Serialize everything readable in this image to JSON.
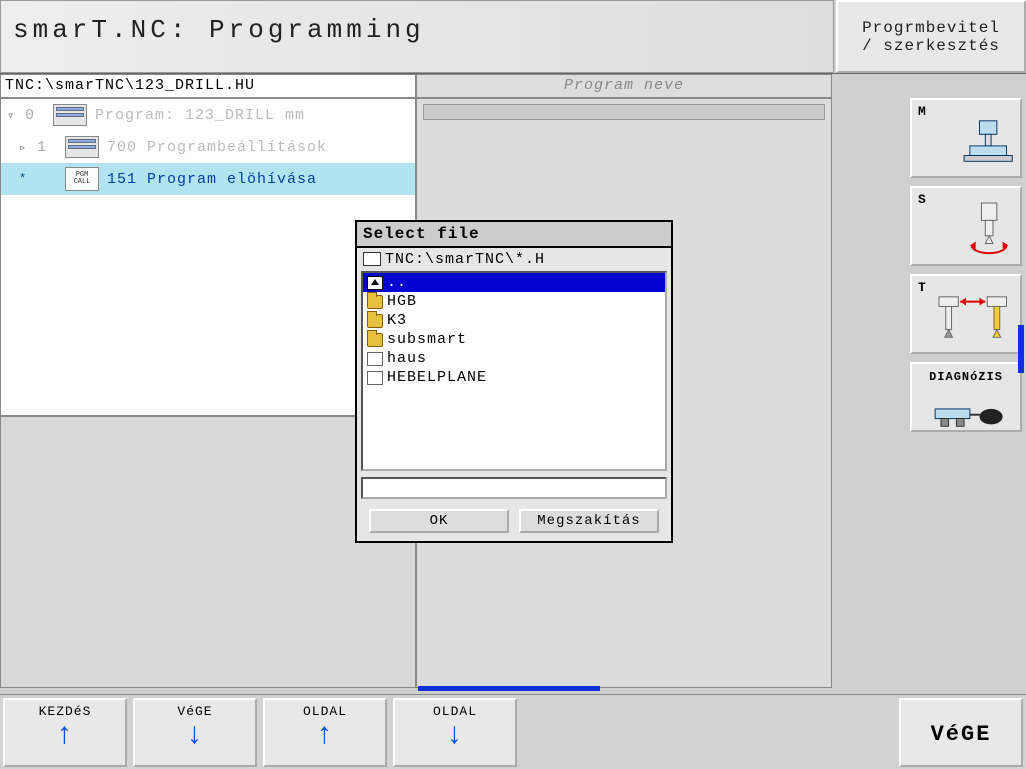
{
  "header": {
    "title": "smarT.NC: Programming",
    "mode_line1": "Progrmbevitel",
    "mode_line2": "/ szerkesztés"
  },
  "path": {
    "left": "TNC:\\smarTNC\\123_DRILL.HU",
    "right": "Program neve"
  },
  "tree": [
    {
      "marker": "▿",
      "index": "0",
      "icon": "blocks",
      "label": "Program: 123_DRILL mm",
      "dim": true,
      "selected": false
    },
    {
      "marker": "▹",
      "index": "1",
      "icon": "blocks",
      "label": "700 Programbeállítások",
      "dim": true,
      "selected": false
    },
    {
      "marker": "*",
      "index": "",
      "icon": "pgm",
      "label": "151 Program elöhívása",
      "dim": false,
      "selected": true
    }
  ],
  "dialog": {
    "title": "Select file",
    "path": "TNC:\\smarTNC\\*.H",
    "items": [
      {
        "type": "up",
        "name": "..",
        "selected": true
      },
      {
        "type": "folder",
        "name": "HGB",
        "selected": false
      },
      {
        "type": "folder",
        "name": "K3",
        "selected": false
      },
      {
        "type": "folder",
        "name": "subsmart",
        "selected": false
      },
      {
        "type": "file",
        "name": "haus",
        "selected": false
      },
      {
        "type": "file",
        "name": "HEBELPLANE",
        "selected": false
      }
    ],
    "ok": "OK",
    "cancel": "Megszakítás"
  },
  "sidebar": {
    "m": "M",
    "s": "S",
    "t": "T",
    "diag": "DIAGNóZIS"
  },
  "footer": {
    "b1": "KEZDéS",
    "b2": "VéGE",
    "b3": "OLDAL",
    "b4": "OLDAL",
    "end": "VéGE"
  }
}
